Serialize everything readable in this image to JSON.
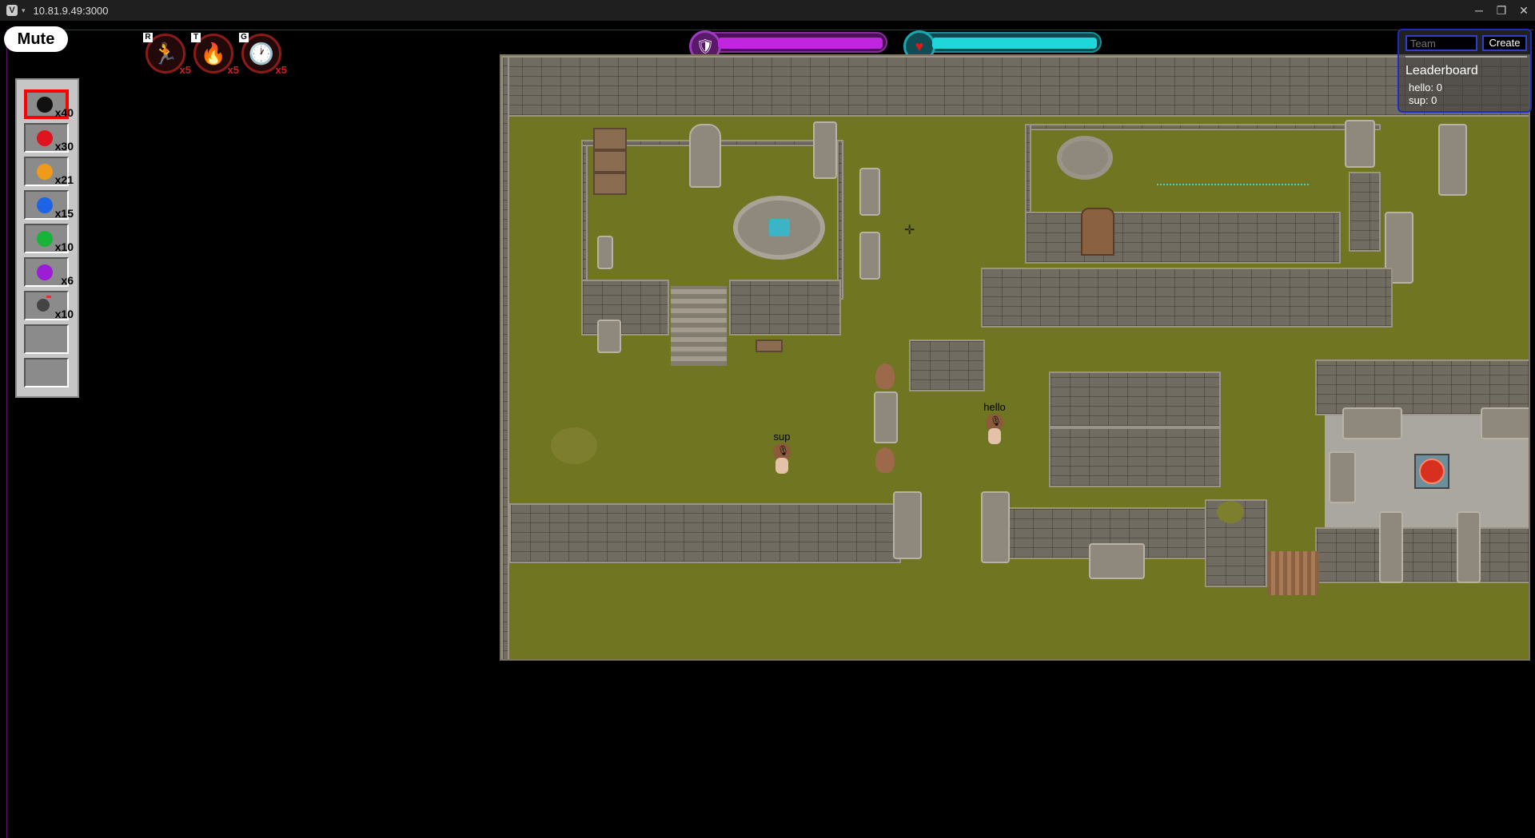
{
  "browser": {
    "url": "10.81.9.49:3000",
    "caret": "▾",
    "logo": "V",
    "window_buttons": [
      "─",
      "❐",
      "✕"
    ]
  },
  "controls": {
    "mute_label": "Mute"
  },
  "abilities": [
    {
      "key": "R",
      "icon": "sprint-icon",
      "glyph": "🏃",
      "count": "x5"
    },
    {
      "key": "T",
      "icon": "fire-icon",
      "glyph": "🔥",
      "count": "x5"
    },
    {
      "key": "G",
      "icon": "clock-icon",
      "glyph": "🕐",
      "count": "x5"
    }
  ],
  "hotbar": {
    "slots": [
      {
        "item": "black-gem",
        "color": "#111111",
        "count": "x40",
        "selected": true
      },
      {
        "item": "red-gem",
        "color": "#e0141e",
        "count": "x30"
      },
      {
        "item": "orange-gem",
        "color": "#f09a1c",
        "count": "x21"
      },
      {
        "item": "blue-gem",
        "color": "#1e64e6",
        "count": "x15"
      },
      {
        "item": "green-gem",
        "color": "#18b43a",
        "count": "x10"
      },
      {
        "item": "purple-gem",
        "color": "#9b1ed6",
        "count": "x6"
      },
      {
        "item": "bomb",
        "color": "#444444",
        "count": "x10"
      },
      {
        "item": "empty",
        "count": ""
      },
      {
        "item": "empty",
        "count": ""
      }
    ]
  },
  "status": {
    "shield": {
      "level": 1.0,
      "color": "#c026e0"
    },
    "health": {
      "level": 1.0,
      "color": "#1fd6da"
    }
  },
  "players": [
    {
      "name": "sup"
    },
    {
      "name": "hello"
    }
  ],
  "team": {
    "input_placeholder": "Team",
    "create_label": "Create",
    "leaderboard_title": "Leaderboard",
    "entries": [
      "hello: 0",
      "sup: 0"
    ]
  }
}
